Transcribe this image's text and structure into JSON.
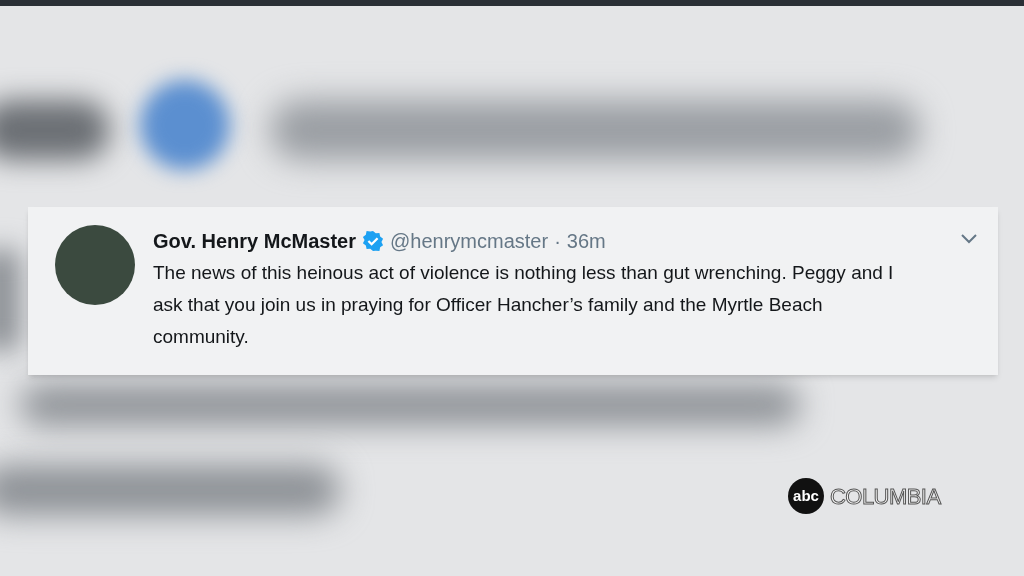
{
  "tweet": {
    "name": "Gov. Henry McMaster",
    "verified": true,
    "handle": "@henrymcmaster",
    "separator": "·",
    "time": "36m",
    "text": "The news of this heinous act of violence is nothing less than gut wrenching. Peggy and I ask that you join us in praying for Officer Hancher’s family and the Myrtle Beach community."
  },
  "station_logo": {
    "mark": "abc",
    "name": "COLUMBIA"
  }
}
